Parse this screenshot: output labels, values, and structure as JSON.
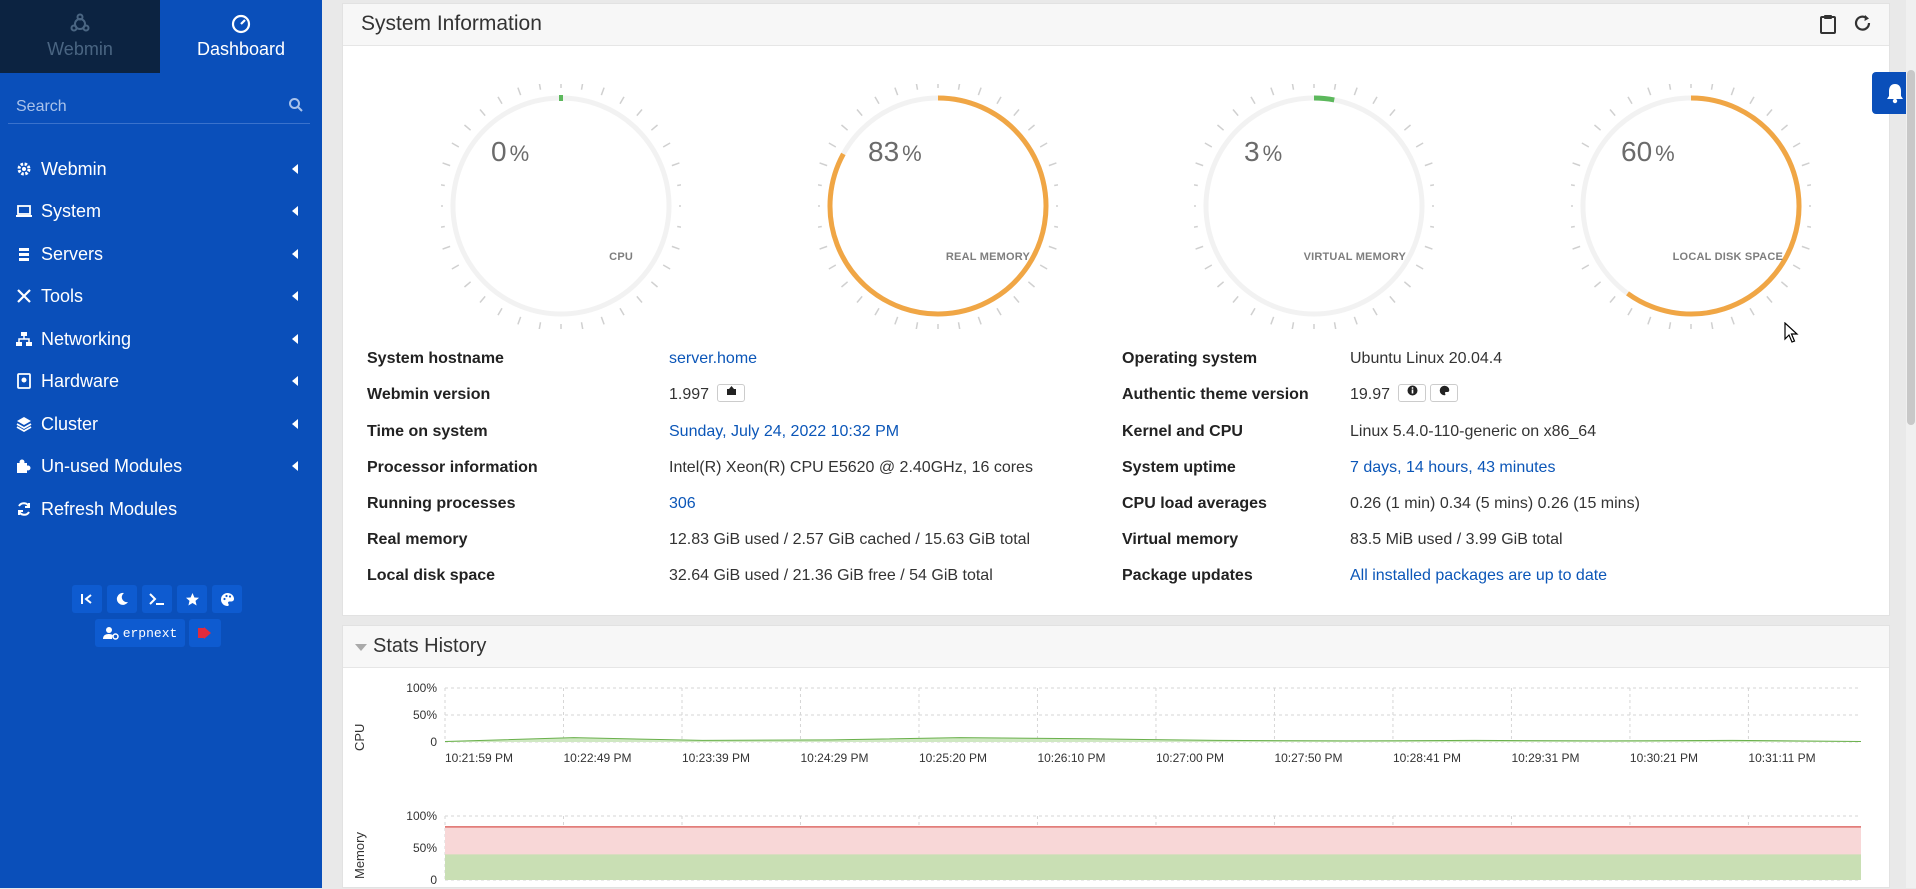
{
  "sidebar": {
    "switch": {
      "webmin": "Webmin",
      "dashboard": "Dashboard"
    },
    "search_placeholder": "Search",
    "menu": [
      {
        "label": "Webmin",
        "icon": "gear-icon"
      },
      {
        "label": "System",
        "icon": "laptop-icon"
      },
      {
        "label": "Servers",
        "icon": "database-icon"
      },
      {
        "label": "Tools",
        "icon": "tools-icon"
      },
      {
        "label": "Networking",
        "icon": "network-icon"
      },
      {
        "label": "Hardware",
        "icon": "hdd-icon"
      },
      {
        "label": "Cluster",
        "icon": "layers-icon"
      },
      {
        "label": "Un-used Modules",
        "icon": "puzzle-icon"
      },
      {
        "label": "Refresh Modules",
        "icon": "refresh-icon"
      }
    ],
    "toolbar_icons": [
      "collapse-icon",
      "moon-icon",
      "terminal-icon",
      "star-icon",
      "palette-icon"
    ],
    "user": "erpnext"
  },
  "system_info": {
    "title": "System Information",
    "gauges": [
      {
        "value": "0",
        "unit": "%",
        "label": "CPU",
        "level": 0
      },
      {
        "value": "83",
        "unit": "%",
        "label": "REAL MEMORY",
        "level": 0.83
      },
      {
        "value": "3",
        "unit": "%",
        "label": "VIRTUAL MEMORY",
        "level": 0.03
      },
      {
        "value": "60",
        "unit": "%",
        "label": "LOCAL DISK SPACE",
        "level": 0.6
      }
    ],
    "colors": {
      "gauge_fill": "#f0a645",
      "gauge_low": "#5cb85c",
      "gauge_track": "#f2f2f2",
      "link": "#0b56b8",
      "sidebar": "#0a4fba"
    },
    "left": [
      {
        "key": "System hostname",
        "value": "server.home",
        "link": true
      },
      {
        "key": "Webmin version",
        "value": "1.997",
        "link": false
      },
      {
        "key": "Time on system",
        "value": "Sunday, July 24, 2022 10:32 PM",
        "link": true
      },
      {
        "key": "Processor information",
        "value": "Intel(R) Xeon(R) CPU E5620 @ 2.40GHz, 16 cores",
        "link": false
      },
      {
        "key": "Running processes",
        "value": "306",
        "link": true
      },
      {
        "key": "Real memory",
        "value": "12.83 GiB used / 2.57 GiB cached / 15.63 GiB total",
        "link": false
      },
      {
        "key": "Local disk space",
        "value": "32.64 GiB used / 21.36 GiB free / 54 GiB total",
        "link": false
      }
    ],
    "right": [
      {
        "key": "Operating system",
        "value": "Ubuntu Linux 20.04.4",
        "link": false
      },
      {
        "key": "Authentic theme version",
        "value": "19.97",
        "link": false
      },
      {
        "key": "Kernel and CPU",
        "value": "Linux 5.4.0-110-generic on x86_64",
        "link": false
      },
      {
        "key": "System uptime",
        "value": "7 days, 14 hours, 43 minutes",
        "link": true
      },
      {
        "key": "CPU load averages",
        "value": "0.26 (1 min) 0.34 (5 mins) 0.26 (15 mins)",
        "link": false
      },
      {
        "key": "Virtual memory",
        "value": "83.5 MiB used / 3.99 GiB total",
        "link": false
      },
      {
        "key": "Package updates",
        "value": "All installed packages are up to date",
        "link": true
      }
    ]
  },
  "stats_history": {
    "title": "Stats History",
    "cpu_label": "CPU",
    "memory_label": "Memory",
    "y_ticks": [
      "100%",
      "50%",
      "0"
    ],
    "x_ticks": [
      "10:21:59 PM",
      "10:22:49 PM",
      "10:23:39 PM",
      "10:24:29 PM",
      "10:25:20 PM",
      "10:26:10 PM",
      "10:27:00 PM",
      "10:27:50 PM",
      "10:28:41 PM",
      "10:29:31 PM",
      "10:30:21 PM",
      "10:31:11 PM"
    ]
  },
  "chart_data": [
    {
      "type": "area",
      "title": "",
      "ylabel": "CPU",
      "ylim": [
        0,
        100
      ],
      "x": [
        "10:21:59 PM",
        "10:22:49 PM",
        "10:23:39 PM",
        "10:24:29 PM",
        "10:25:20 PM",
        "10:26:10 PM",
        "10:27:00 PM",
        "10:27:50 PM",
        "10:28:41 PM",
        "10:29:31 PM",
        "10:30:21 PM",
        "10:31:11 PM"
      ],
      "series": [
        {
          "values": [
            1,
            8,
            3,
            4,
            8,
            6,
            3,
            2,
            3,
            2,
            3,
            1
          ]
        }
      ]
    },
    {
      "type": "area",
      "title": "",
      "ylabel": "Memory",
      "ylim": [
        0,
        100
      ],
      "x": [
        "10:21:59 PM",
        "10:22:49 PM",
        "10:23:39 PM",
        "10:24:29 PM",
        "10:25:20 PM",
        "10:26:10 PM",
        "10:27:00 PM",
        "10:27:50 PM",
        "10:28:41 PM",
        "10:29:31 PM",
        "10:30:21 PM",
        "10:31:11 PM"
      ],
      "series": [
        {
          "values": [
            83,
            83,
            83,
            83,
            83,
            83,
            83,
            83,
            83,
            83,
            83,
            83
          ]
        },
        {
          "values": [
            40,
            40,
            40,
            40,
            40,
            40,
            40,
            40,
            40,
            40,
            40,
            40
          ]
        }
      ]
    }
  ]
}
